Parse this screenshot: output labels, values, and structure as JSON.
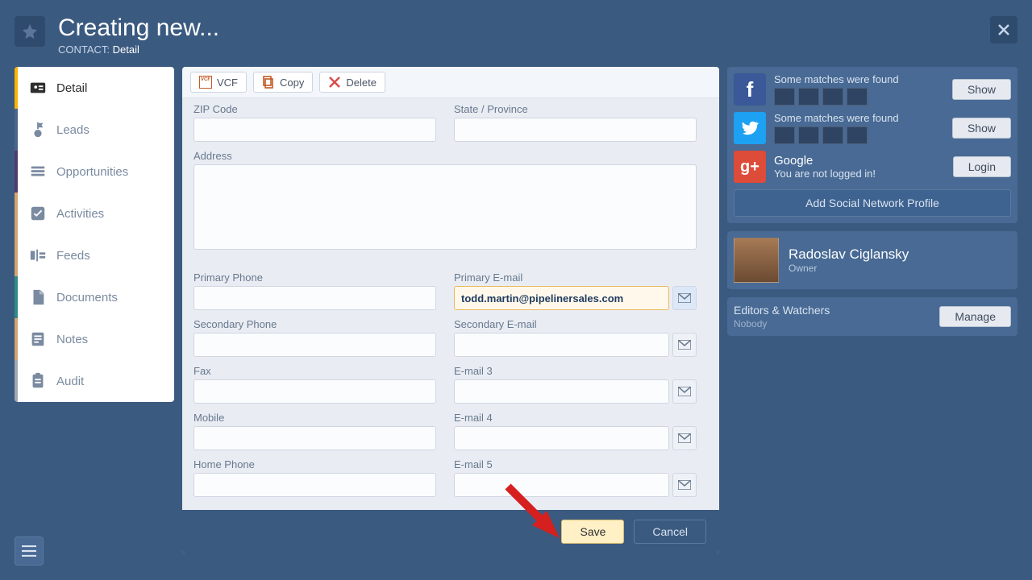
{
  "header": {
    "title": "Creating new...",
    "subtitle_prefix": "CONTACT:",
    "subtitle_strong": "Detail"
  },
  "sidebar": {
    "items": [
      {
        "label": "Detail"
      },
      {
        "label": "Leads"
      },
      {
        "label": "Opportunities"
      },
      {
        "label": "Activities"
      },
      {
        "label": "Feeds"
      },
      {
        "label": "Documents"
      },
      {
        "label": "Notes"
      },
      {
        "label": "Audit"
      }
    ]
  },
  "toolbar": {
    "vcf_label": "VCF",
    "copy_label": "Copy",
    "delete_label": "Delete"
  },
  "form": {
    "zip_label": "ZIP Code",
    "state_label": "State / Province",
    "address_label": "Address",
    "primary_phone_label": "Primary Phone",
    "primary_email_label": "Primary E-mail",
    "primary_email_value": "todd.martin@pipelinersales.com",
    "secondary_phone_label": "Secondary Phone",
    "secondary_email_label": "Secondary E-mail",
    "fax_label": "Fax",
    "email3_label": "E-mail 3",
    "mobile_label": "Mobile",
    "email4_label": "E-mail 4",
    "home_phone_label": "Home Phone",
    "email5_label": "E-mail 5"
  },
  "buttons": {
    "save": "Save",
    "cancel": "Cancel",
    "show": "Show",
    "login": "Login",
    "manage": "Manage"
  },
  "social": {
    "fb_msg": "Some matches were found",
    "tw_msg": "Some matches were found",
    "gp_name": "Google",
    "gp_msg": "You are not logged in!",
    "add_label": "Add Social Network Profile"
  },
  "owner": {
    "name": "Radoslav Ciglansky",
    "role": "Owner"
  },
  "watchers": {
    "title": "Editors & Watchers",
    "subtitle": "Nobody"
  }
}
